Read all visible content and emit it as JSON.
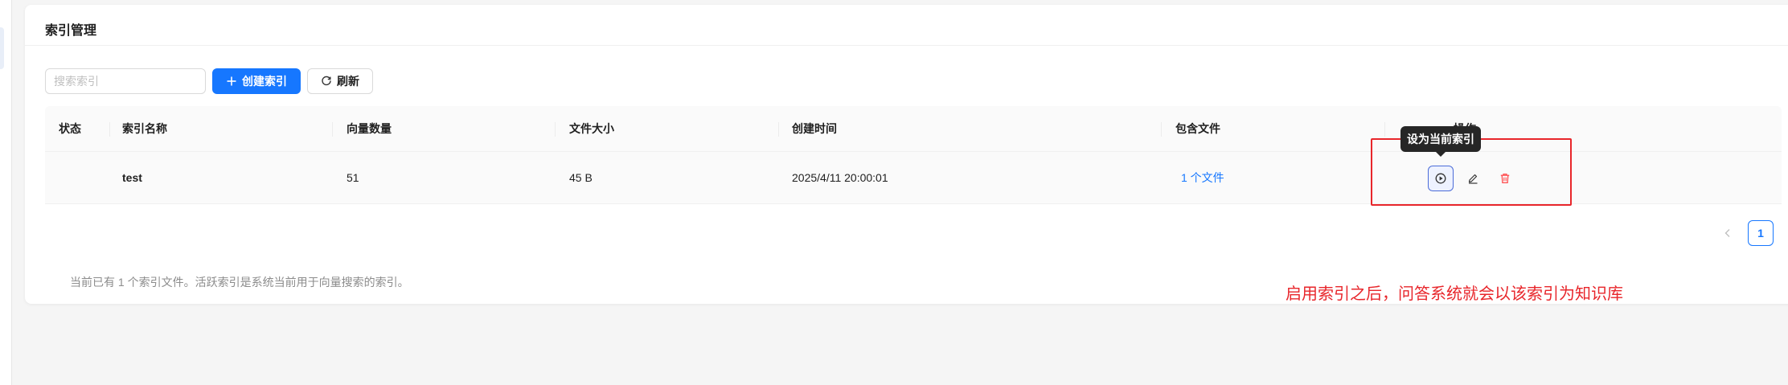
{
  "sidebar": {},
  "page": {
    "title": "索引管理"
  },
  "toolbar": {
    "search_placeholder": "搜索索引",
    "create_label": "创建索引",
    "refresh_label": "刷新"
  },
  "table": {
    "headers": [
      "状态",
      "索引名称",
      "向量数量",
      "文件大小",
      "创建时间",
      "包含文件",
      "操作"
    ],
    "rows": [
      {
        "status": "",
        "name": "test",
        "vectors": "51",
        "size": "45 B",
        "created": "2025/4/11 20:00:01",
        "files": "1 个文件"
      }
    ]
  },
  "tooltip": {
    "text": "设为当前索引"
  },
  "pagination": {
    "current": "1"
  },
  "summary": "当前已有 1 个索引文件。活跃索引是系统当前用于向量搜索的索引。",
  "annotation": {
    "text": "启用索引之后，问答系统就会以该索引为知识库",
    "color": "#e8262b"
  },
  "colors": {
    "primary": "#1677ff",
    "danger": "#ff4d4f"
  },
  "icons": {
    "activate": "play-circle-icon",
    "edit": "edit-icon",
    "delete": "delete-icon",
    "search": "search-icon",
    "plus": "plus-icon",
    "refresh": "refresh-icon"
  }
}
